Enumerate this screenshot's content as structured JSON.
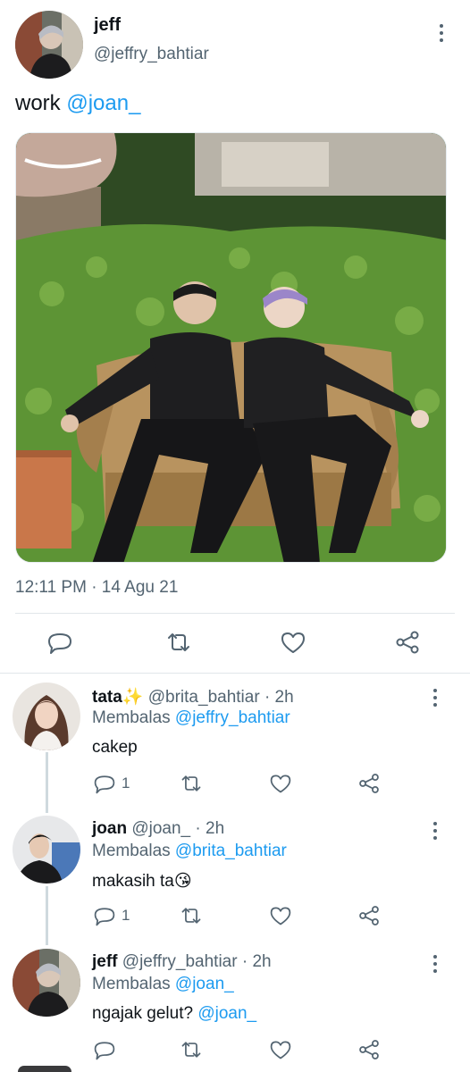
{
  "tweet": {
    "author_name": "jeff",
    "author_handle": "@jeffry_bahtiar",
    "text_prefix": "work ",
    "text_mention": "@joan_",
    "timestamp": "12:11 PM · 14 Agu 21"
  },
  "actions": [
    "reply-icon",
    "retweet-icon",
    "like-icon",
    "share-icon"
  ],
  "replies": [
    {
      "name": "tata",
      "badge": "✨",
      "handle": "@brita_bahtiar",
      "time": "· 2h",
      "replying_label": "Membalas ",
      "replying_to": "@jeffry_bahtiar",
      "text": "cakep",
      "text_mention": "",
      "reply_count": "1"
    },
    {
      "name": "joan",
      "badge": "",
      "handle": "@joan_",
      "time": "· 2h",
      "replying_label": "Membalas ",
      "replying_to": "@brita_bahtiar",
      "text": "makasih ta",
      "emoji": "😘",
      "reply_count": "1"
    },
    {
      "name": "jeff",
      "badge": "",
      "handle": "@jeffry_bahtiar",
      "time": "· 2h",
      "replying_label": "Membalas ",
      "replying_to": "@joan_",
      "text": "ngajak gelut? ",
      "text_mention": "@joan_",
      "reply_count": ""
    }
  ],
  "colors": {
    "link": "#1d9bf0",
    "muted": "#536471",
    "divider": "#e1e6ea",
    "thread_line": "#cfd9de"
  }
}
